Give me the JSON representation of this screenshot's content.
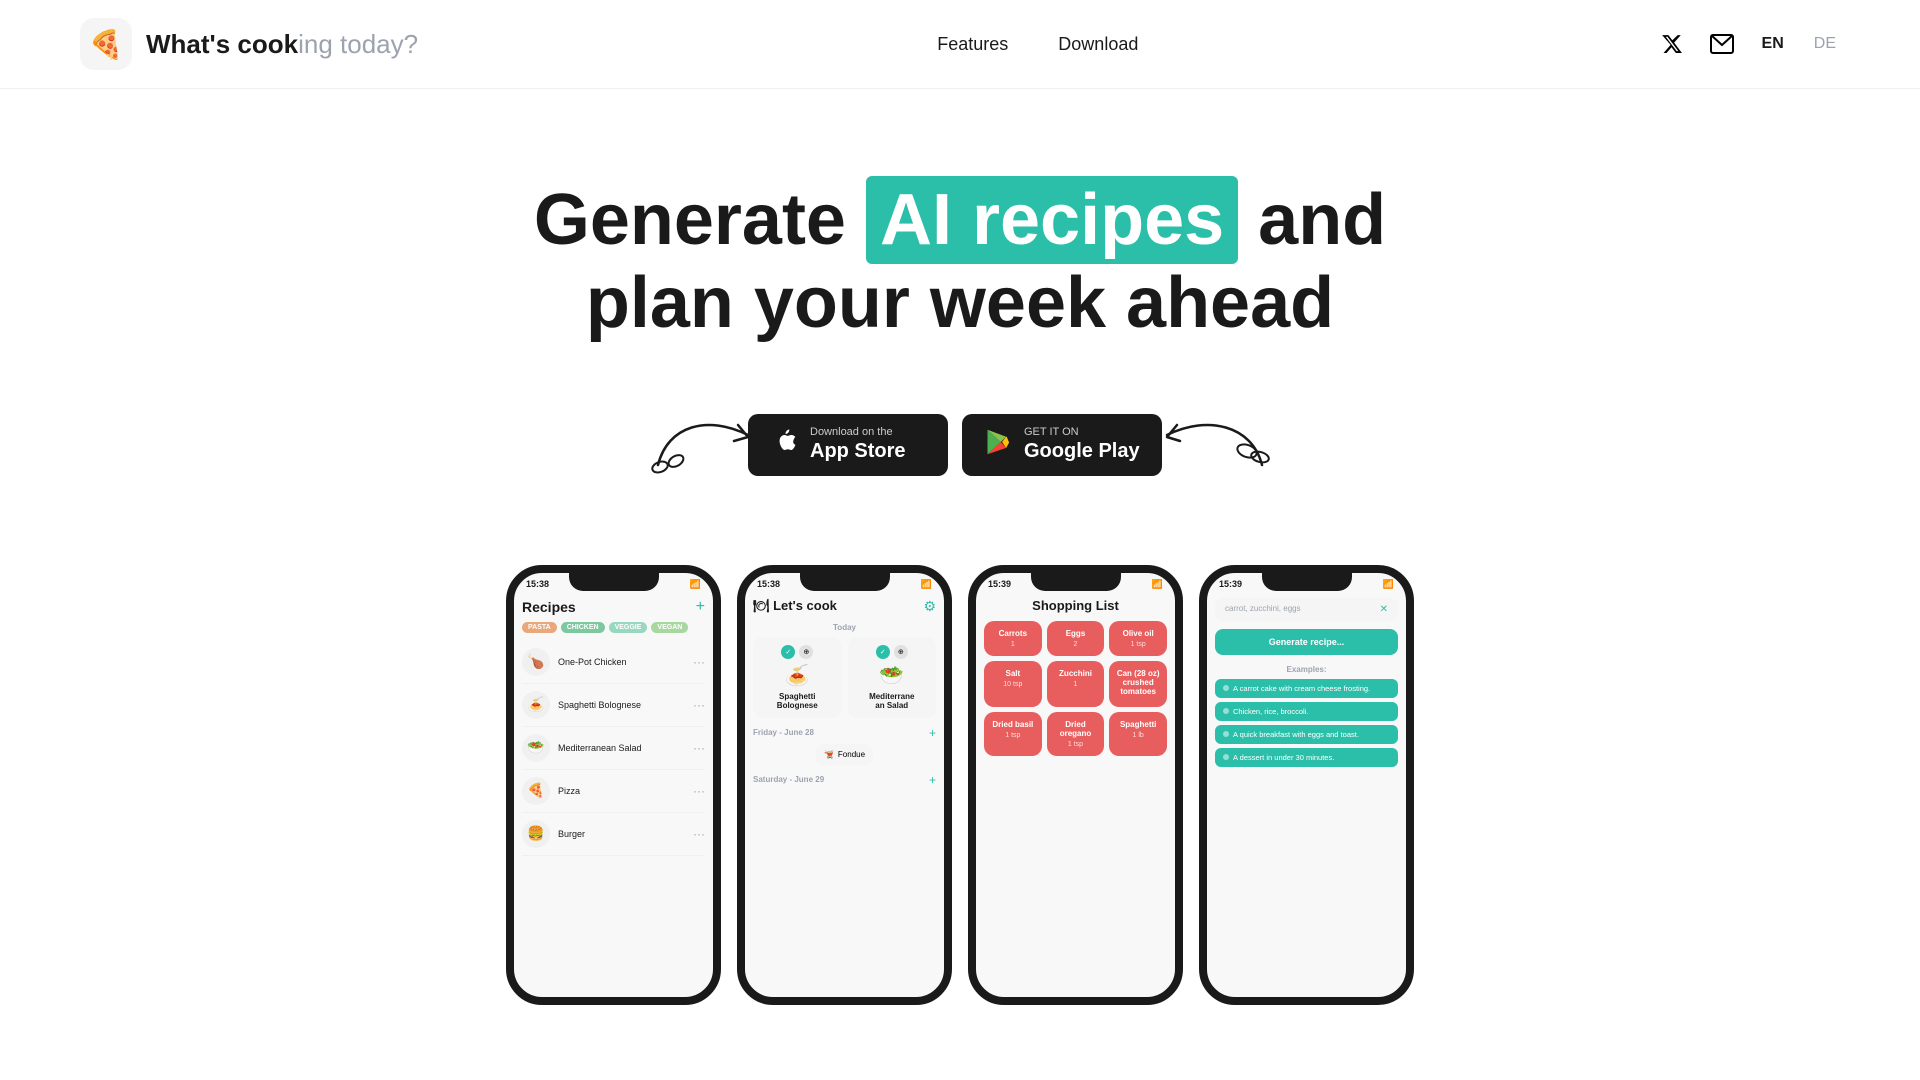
{
  "nav": {
    "logo_emoji": "🍕",
    "logo_text_normal": "What's cook",
    "logo_text_highlight": "ing today?",
    "links": [
      {
        "label": "Features",
        "id": "features"
      },
      {
        "label": "Download",
        "id": "download"
      }
    ],
    "lang_en": "EN",
    "lang_de": "DE",
    "twitter_icon": "✕",
    "mail_icon": "✉"
  },
  "hero": {
    "title_before": "Generate ",
    "title_highlight": "AI recipes",
    "title_after": " and",
    "title_line2": "plan your week ahead"
  },
  "store_buttons": {
    "appstore": {
      "sub": "Download on the",
      "main": "App Store",
      "icon": ""
    },
    "googleplay": {
      "sub": "GET IT ON",
      "main": "Google Play"
    }
  },
  "phones": {
    "phone1": {
      "time": "15:38",
      "title": "Recipes",
      "tags": [
        "PASTA",
        "CHICKEN",
        "VEGGIE",
        "VEGAN"
      ],
      "recipes": [
        {
          "emoji": "🍗",
          "name": "One-Pot Chicken"
        },
        {
          "emoji": "🍝",
          "name": "Spaghetti Bolognese"
        },
        {
          "emoji": "🥗",
          "name": "Mediterranean Salad"
        },
        {
          "emoji": "🍕",
          "name": "Pizza"
        },
        {
          "emoji": "🍔",
          "name": "Burger"
        }
      ]
    },
    "phone2": {
      "time": "15:38",
      "title": "🍽 Let's cook",
      "today": "Today",
      "meals_today": [
        {
          "emoji": "🍝",
          "name": "Spaghetti\nBolognese"
        },
        {
          "emoji": "🥗",
          "name": "Mediterrane\nan Salad"
        }
      ],
      "friday": "Friday - June 28",
      "meal_friday": {
        "emoji": "🫕",
        "name": "Fondue"
      },
      "saturday": "Saturday - June 29"
    },
    "phone3": {
      "time": "15:39",
      "title": "Shopping List",
      "items": [
        {
          "name": "Carrots",
          "qty": "1"
        },
        {
          "name": "Eggs",
          "qty": "2"
        },
        {
          "name": "Olive oil",
          "qty": "1 tsp"
        },
        {
          "name": "Salt",
          "qty": "10 tsp"
        },
        {
          "name": "Zucchini",
          "qty": "1"
        },
        {
          "name": "Can (28 oz) crushed tomatoes",
          "qty": ""
        },
        {
          "name": "Dried basil",
          "qty": "1 tsp"
        },
        {
          "name": "Dried oregano",
          "qty": "1 tsp"
        },
        {
          "name": "Spaghetti",
          "qty": "1 lb"
        }
      ]
    },
    "phone4": {
      "time": "15:39",
      "input_placeholder": "carrot, zucchini, eggs",
      "generate_btn": "Generate recipe...",
      "examples_label": "Examples:",
      "examples": [
        "A carrot cake with cream cheese frosting.",
        "Chicken, rice, broccoli.",
        "A quick breakfast with eggs and toast.",
        "A dessert in under 30 minutes."
      ]
    }
  }
}
